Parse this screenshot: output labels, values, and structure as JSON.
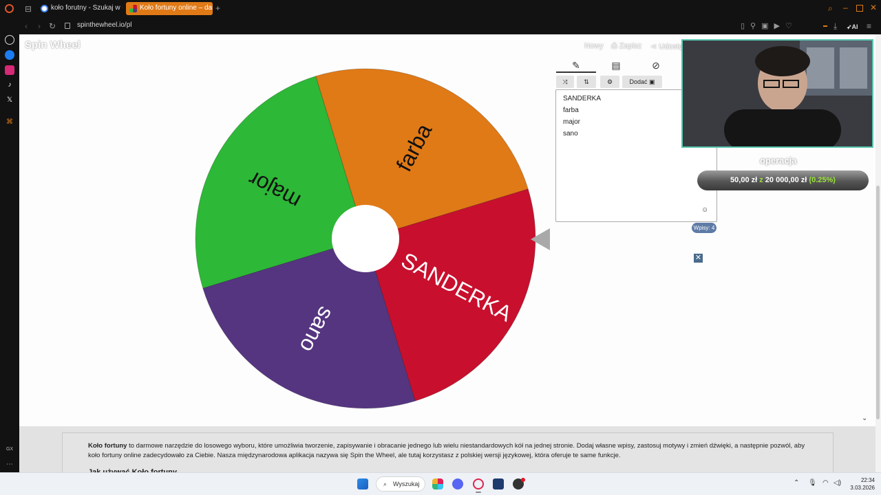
{
  "browser": {
    "tabs": [
      {
        "label": "koło forutny - Szukaj w Go",
        "active": false
      },
      {
        "label": "Koło fortuny online – darm",
        "active": true
      }
    ],
    "url": "spinthewheel.io/pl"
  },
  "site": {
    "logo": "Spin Wheel",
    "links": {
      "new": "Nowy",
      "save": "Zapisz",
      "share": "Udostę"
    }
  },
  "editor": {
    "add_button": "Dodać",
    "entries": [
      "SANDERKA",
      "farba",
      "major",
      "sano"
    ],
    "count_label": "Wpisy: 4"
  },
  "wheel": {
    "segments": [
      {
        "label": "SANDERKA",
        "color": "#c8102e"
      },
      {
        "label": "sano",
        "color": "#553580"
      },
      {
        "label": "major",
        "color": "#2db837"
      },
      {
        "label": "farba",
        "color": "#e07a16"
      }
    ]
  },
  "overlay": {
    "title": "operacja",
    "raised": "50,00 zł",
    "connector": "z",
    "goal": "20 000,00 zł",
    "percent": "(0.25%)"
  },
  "info": {
    "bold_lead": "Koło fortuny",
    "text": "to darmowe narzędzie do losowego wyboru, które umożliwia tworzenie, zapisywanie i obracanie jednego lub wielu niestandardowych kół na jednej stronie. Dodaj własne wpisy, zastosuj motywy i zmień dźwięki, a następnie pozwól, aby koło fortuny online zadecydowało za Ciebie. Nasza międzynarodowa aplikacja nazywa się Spin the Wheel, ale tutaj korzystasz z polskiej wersji językowej, która oferuje te same funkcje.",
    "heading": "Jak używać Koło fortuny"
  },
  "taskbar": {
    "search": "Wyszukaj",
    "time": "22:34",
    "date": "3.03.2026"
  },
  "colors": {
    "accent_webcam_border": "#58c7b0",
    "goal_green": "#9be33a"
  }
}
